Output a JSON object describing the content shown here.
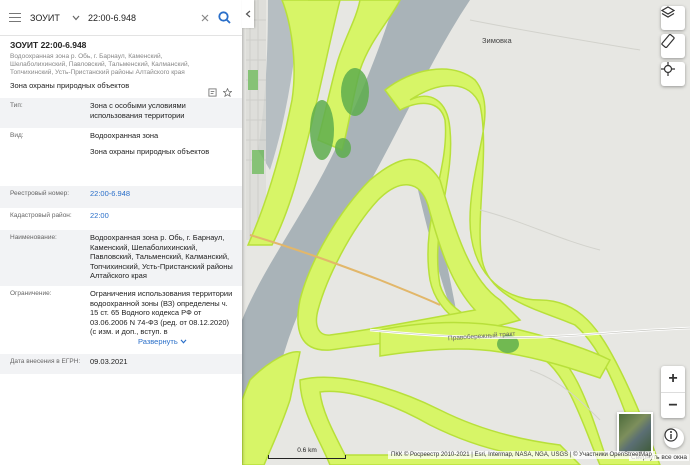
{
  "search": {
    "type_value": "ЗОУИТ",
    "query": "22:00-6.948",
    "placeholder": ""
  },
  "object": {
    "title": "ЗОУИТ 22:00-6.948",
    "subtitle": "Водоохранная зона р. Обь, г. Барнаул, Каменский, Шелаболихинский, Павловский, Тальменский, Калманский, Топчихинский, Усть-Пристанский районы Алтайского края",
    "type_text": "Зона охраны природных объектов"
  },
  "attributes": {
    "type": {
      "label": "Тип:",
      "value": "Зона с особыми условиями использования территории"
    },
    "kind": {
      "label": "Вид:",
      "value_1": "Водоохранная зона",
      "value_2": "Зона охраны природных объектов"
    },
    "registry": {
      "label": "Реестровый номер:",
      "value": "22:00-6.948"
    },
    "cadastral": {
      "label": "Кадастровый район:",
      "value": "22:00"
    },
    "name": {
      "label": "Наименование:",
      "value": "Водоохранная зона р. Обь, г. Барнаул, Каменский, Шелаболихинский, Павловский, Тальменский, Калманский, Топчихинский, Усть-Пристанский районы Алтайского края"
    },
    "limit": {
      "label": "Ограничение:",
      "value": "Ограничения использования территории водоохранной зоны (ВЗ) определены ч. 15 ст. 65 Водного кодекса РФ от 03.06.2006 N 74-ФЗ (ред. от 08.12.2020) (с изм. и доп., вступ. в",
      "expand_label": "Развернуть"
    },
    "date": {
      "label": "Дата внесения в ЕГРН:",
      "value": "09.03.2021"
    }
  },
  "map": {
    "village_label": "Зимовка",
    "road_label": "Правобережный тракт",
    "attribution": "ПКК © Росреестр 2010-2021 | Esri, Intermap, NASA, NGA, USGS | © Участники OpenStreetMap",
    "scale_label": "0.6 km",
    "basemap_collapse_label": "Свернуть все окна",
    "zoom_in_label": "+",
    "zoom_out_label": "−"
  },
  "colors": {
    "zone_fill": "#d7f567",
    "zone_stroke": "#b8e03a",
    "water": "#a9b3b8",
    "land": "#e7e7e3",
    "forest": "#5fae4e",
    "link": "#2a6fc9"
  },
  "icons": {
    "menu": "menu-icon",
    "dropdown": "chevron-down-icon",
    "clear": "close-icon",
    "search": "search-icon",
    "layers": "layers-icon",
    "ruler": "ruler-icon",
    "locate": "crosshair-icon",
    "info": "info-icon",
    "print": "print-icon",
    "favorite": "star-icon"
  }
}
